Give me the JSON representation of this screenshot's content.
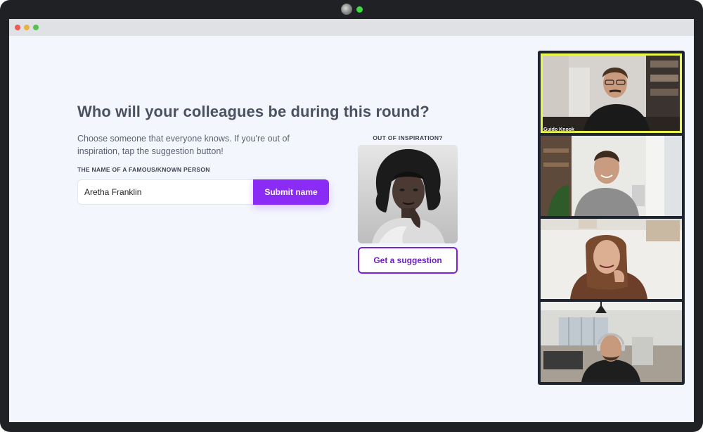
{
  "game": {
    "title": "Who will your colleagues be during this round?",
    "description": "Choose someone that everyone knows. If you're out of inspiration, tap the suggestion button!",
    "field_label": "THE NAME OF A FAMOUS/KNOWN PERSON",
    "name_value": "Aretha Franklin",
    "submit_label": "Submit name"
  },
  "inspiration": {
    "label": "OUT OF INSPIRATION?",
    "button_label": "Get a suggestion"
  },
  "video_call": {
    "participants": [
      {
        "name": "Guido Knook",
        "active": true
      },
      {
        "name": "",
        "active": false
      },
      {
        "name": "",
        "active": false
      },
      {
        "name": "",
        "active": false
      }
    ]
  },
  "colors": {
    "accent": "#8a2cf5",
    "active_speaker": "#e9f84a",
    "background": "#f3f6fd"
  }
}
